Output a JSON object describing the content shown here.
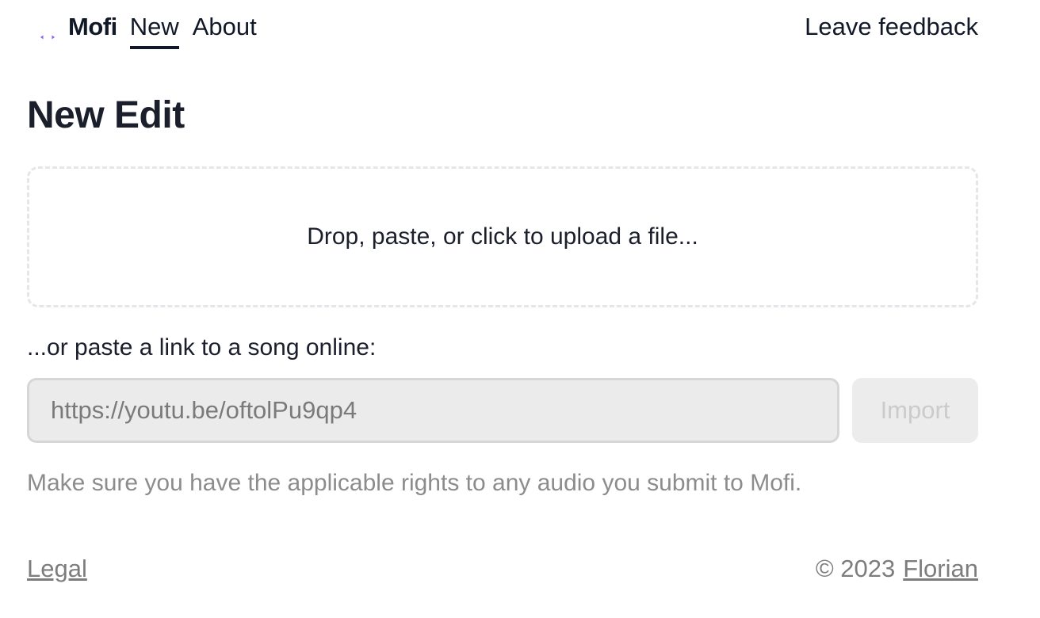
{
  "brand": {
    "name": "Mofi",
    "logo_icon": "waveform-icon",
    "logo_colors": [
      "#8b5cf6",
      "#b79ad6"
    ]
  },
  "nav": {
    "items": [
      {
        "label": "New",
        "active": true
      },
      {
        "label": "About",
        "active": false
      }
    ],
    "feedback_label": "Leave feedback"
  },
  "main": {
    "title": "New Edit",
    "dropzone_label": "Drop, paste, or click to upload a file...",
    "link_label": "...or paste a link to a song online:",
    "url_placeholder": "https://youtu.be/oftolPu9qp4",
    "import_label": "Import",
    "rights_note": "Make sure you have the applicable rights to any audio you submit to Mofi."
  },
  "footer": {
    "legal_label": "Legal",
    "copyright": "© 2023",
    "author_label": "Florian"
  }
}
